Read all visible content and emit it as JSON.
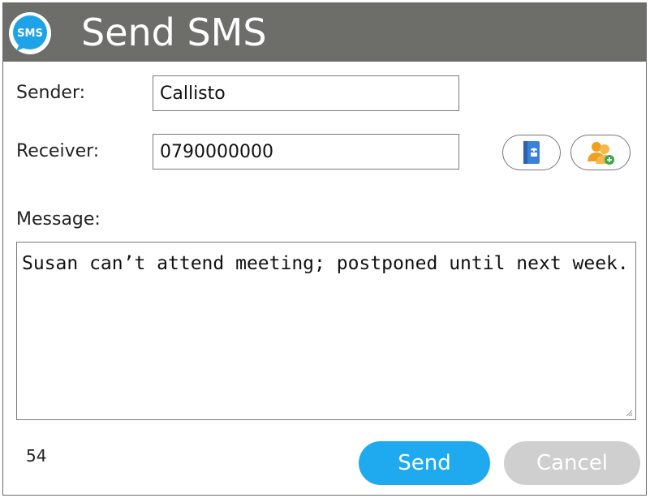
{
  "window": {
    "title": "Send SMS",
    "logo_text": "SMS"
  },
  "form": {
    "sender_label": "Sender:",
    "sender_value": "Callisto",
    "receiver_label": "Receiver:",
    "receiver_value": "0790000000",
    "message_label": "Message:",
    "message_value": "Susan can’t attend meeting; postponed until next week."
  },
  "icons": {
    "phonebook": "phonebook-icon",
    "contacts": "contacts-icon"
  },
  "footer": {
    "char_count": "54",
    "send_label": "Send",
    "cancel_label": "Cancel"
  },
  "colors": {
    "titlebar": "#6d6d69",
    "accent": "#1faaf0",
    "disabled": "#cfcfcf"
  }
}
